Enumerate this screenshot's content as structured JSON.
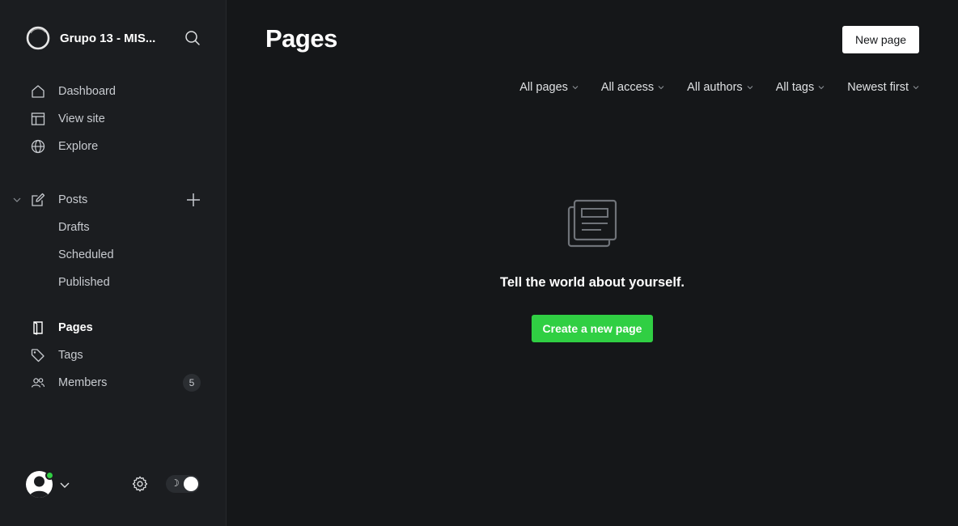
{
  "sidebar": {
    "site_name": "Grupo 13 - MIS...",
    "nav_primary": [
      {
        "label": "Dashboard",
        "icon": "home-icon"
      },
      {
        "label": "View site",
        "icon": "layout-icon"
      },
      {
        "label": "Explore",
        "icon": "globe-icon"
      }
    ],
    "posts": {
      "label": "Posts",
      "icon": "edit-icon",
      "sub": [
        {
          "label": "Drafts"
        },
        {
          "label": "Scheduled"
        },
        {
          "label": "Published"
        }
      ]
    },
    "nav_secondary": [
      {
        "label": "Pages",
        "icon": "page-icon",
        "active": true
      },
      {
        "label": "Tags",
        "icon": "tag-icon"
      },
      {
        "label": "Members",
        "icon": "members-icon",
        "badge": "5"
      }
    ]
  },
  "main": {
    "title": "Pages",
    "new_page_label": "New page",
    "filters": [
      {
        "label": "All pages"
      },
      {
        "label": "All access"
      },
      {
        "label": "All authors"
      },
      {
        "label": "All tags"
      },
      {
        "label": "Newest first"
      }
    ],
    "empty": {
      "message": "Tell the world about yourself.",
      "cta_label": "Create a new page"
    }
  },
  "colors": {
    "accent_green": "#30cf43",
    "sidebar_bg": "#1b1d20",
    "main_bg": "#151719"
  }
}
